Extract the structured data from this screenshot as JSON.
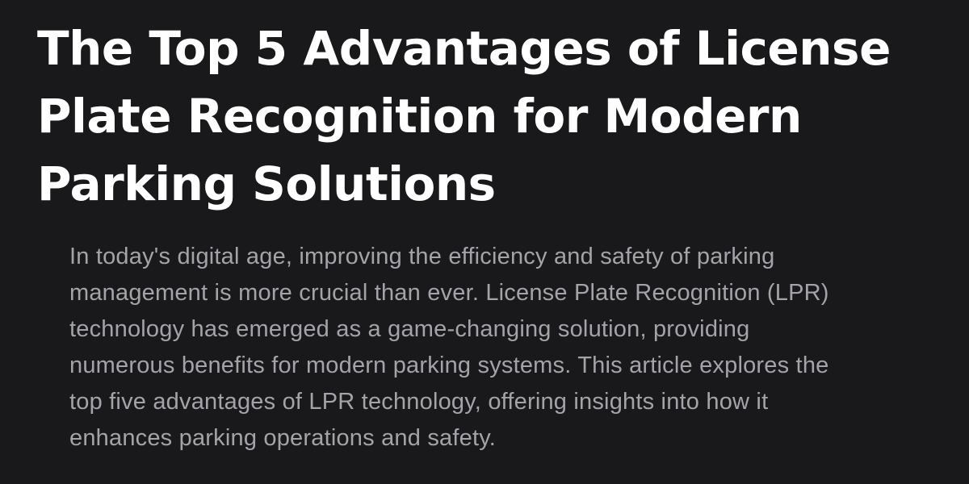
{
  "article": {
    "title": "The Top 5 Advantages of License\nPlate Recognition for Modern\nParking Solutions",
    "intro": "In today's digital age, improving the efficiency and safety of parking\nmanagement is more crucial than ever. License Plate Recognition (LPR)\ntechnology has emerged as a game-changing solution, providing\nnumerous benefits for modern parking systems. This article explores the\ntop five advantages of LPR technology, offering insights into how it\nenhances parking operations and safety."
  },
  "colors": {
    "background": "#19191b",
    "title": "#ffffff",
    "body_text": "#a3a3a9"
  }
}
